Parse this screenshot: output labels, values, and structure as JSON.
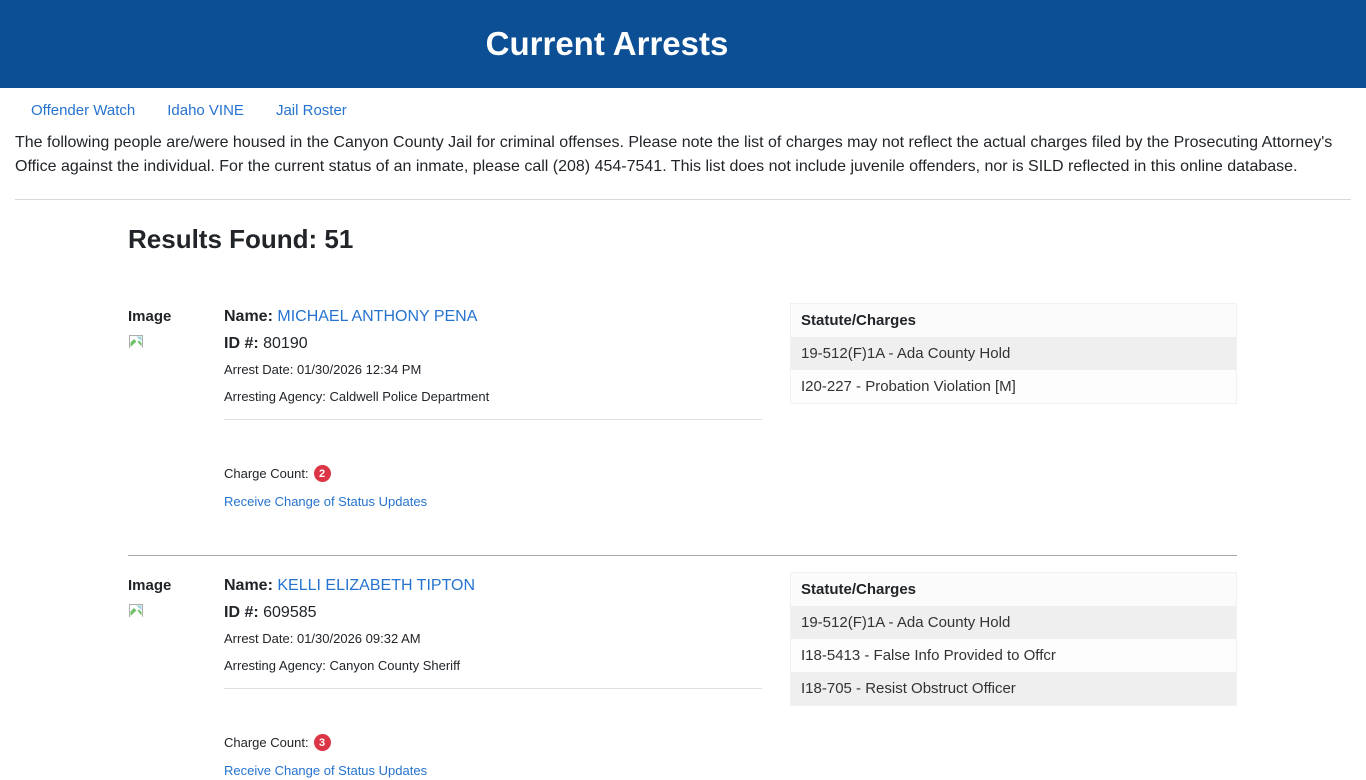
{
  "header": {
    "title": "Current Arrests",
    "bg_color": "#0d4f94"
  },
  "nav": {
    "items": [
      {
        "label": "Offender Watch"
      },
      {
        "label": "Idaho VINE"
      },
      {
        "label": "Jail Roster"
      }
    ]
  },
  "intro_text": "The following people are/were housed in the Canyon County Jail for criminal offenses. Please note the list of charges may not reflect the actual charges filed by the Prosecuting Attorney's Office against the individual. For the current status of an inmate, please call (208) 454-7541. This list does not include juvenile offenders, nor is SILD reflected in this online database.",
  "results_heading": "Results Found: 51",
  "labels": {
    "image": "Image",
    "name": "Name:",
    "id": "ID #:",
    "charge_count": "Charge Count:",
    "status_link": "Receive Change of Status Updates",
    "charges_header": "Statute/Charges"
  },
  "colors": {
    "link_blue": "#2673cf",
    "badge_red": "#dc3545",
    "stripe_gray": "#efefef"
  },
  "records": [
    {
      "name": "MICHAEL ANTHONY PENA",
      "id": "80190",
      "arrest_date_line": "Arrest Date: 01/30/2026 12:34 PM",
      "agency_line": "Arresting Agency: Caldwell Police Department",
      "charge_count": "2",
      "charges": [
        "19-512(F)1A - Ada County Hold",
        "I20-227 - Probation Violation [M]"
      ]
    },
    {
      "name": "KELLI ELIZABETH TIPTON",
      "id": "609585",
      "arrest_date_line": "Arrest Date: 01/30/2026 09:32 AM",
      "agency_line": "Arresting Agency: Canyon County Sheriff",
      "charge_count": "3",
      "charges": [
        "19-512(F)1A - Ada County Hold",
        "I18-5413 - False Info Provided to Offcr",
        "I18-705 - Resist Obstruct Officer"
      ]
    }
  ]
}
